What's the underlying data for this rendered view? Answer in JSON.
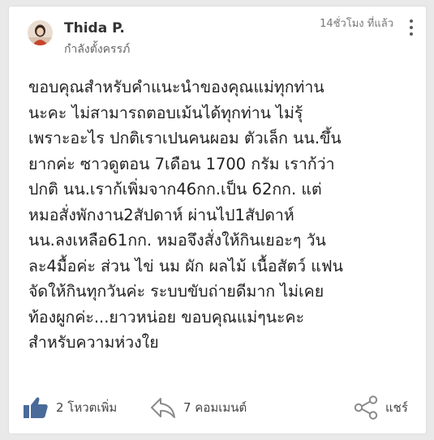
{
  "post": {
    "author": {
      "name": "Thida P.",
      "status": "กำลังตั้งครรภ์"
    },
    "timestamp": "14ชั่วโมง ที่แล้ว",
    "lines": [
      "ขอบคุณสำหรับคำแนะนำของคุณแม่ทุกท่าน",
      "นะคะ ไม่สามารถตอบเม้นได้ทุกท่าน ไม่รุ้",
      "เพราะอะไร ปกติเราเปนคนผอม ตัวเล็ก นน.ขึ้น",
      "ยากค่ะ ซาวดูตอน 7เดือน 1700 กรัม เราก้ว่า",
      "ปกติ นน.เราก้เพิ่มจาก46กก.เป็น 62กก. แต่",
      "หมอสั่งพักงาน2สัปดาห์ ผ่านไป1สัปดาห์",
      "นน.ลงเหลือ61กก. หมอจึงสั่งให้กินเยอะๆ วัน",
      "ละ4มื้อค่ะ ส่วน ไข่ นม ผัก ผลไม้ เนื้อสัตว์ แฟน",
      "จัดให้กินทุกวันค่ะ ระบบขับถ่ายดีมาก ไม่เคย",
      "ท้องผูกค่ะ...ยาวหน่อย ขอบคุณแม่ๆนะคะ",
      "สำหรับความห่วงใย"
    ]
  },
  "actions": {
    "vote_label": "2 โหวตเพิ่ม",
    "comment_label": "7 คอมเมนต์",
    "share_label": "แชร์"
  },
  "icons": {
    "vote": "thumbs-up-icon",
    "comment": "reply-arrow-icon",
    "share": "share-icon",
    "more": "more-vertical-icon"
  },
  "colors": {
    "vote_icon": "#4a6a9a",
    "comment_icon": "#8a8a8a",
    "share_icon": "#8a8a8a",
    "text": "#222222",
    "card_background": "#ffffff",
    "page_background": "#e9e9e9"
  }
}
